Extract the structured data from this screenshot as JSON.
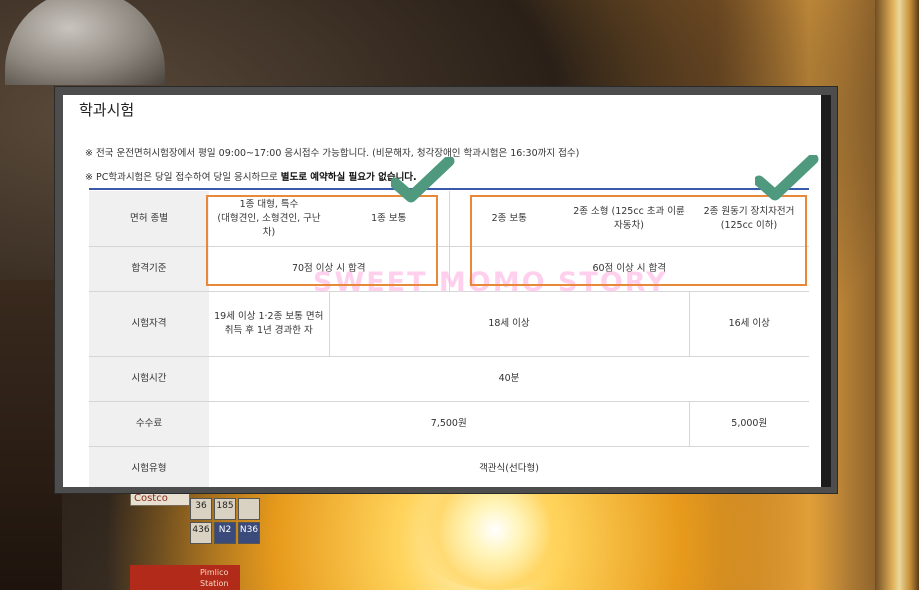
{
  "page": {
    "title": "학과시험",
    "notes": [
      "※ 전국 운전면허시험장에서 평일 09:00~17:00 응시접수 가능합니다. (비문해자, 청각장애인 학과시험은 16:30까지 접수)",
      {
        "prefix": "※ PC학과시험은 당일 접수하여 당일 응시하므로 ",
        "bold": "별도로 예약하실 필요가 없습니다."
      }
    ]
  },
  "watermark": "SWEET MOMO STORY",
  "table": {
    "rows": {
      "license_type": {
        "label": "면허 종별",
        "cells": [
          "1종 대형, 특수\n(대형견인, 소형견인, 구난차)",
          "1종 보통",
          "2종 보통",
          "2종 소형 (125cc 초과 이륜자동차)",
          "2종 원동기 장치자전거 (125cc 이하)"
        ]
      },
      "pass_criteria": {
        "label": "합격기준",
        "cells": [
          "70점 이상 시 합격",
          "60점 이상 시 합격"
        ]
      },
      "eligibility": {
        "label": "시험자격",
        "cells": [
          "19세 이상 1·2종 보통 면허 취득 후 1년 경과한 자",
          "18세 이상",
          "16세 이상"
        ]
      },
      "exam_time": {
        "label": "시험시간",
        "cells": [
          "40분"
        ]
      },
      "fee": {
        "label": "수수료",
        "cells": [
          "7,500원",
          "5,000원"
        ]
      },
      "exam_type": {
        "label": "시험유형",
        "cells": [
          "객관식(선다형)"
        ]
      }
    }
  },
  "background": {
    "shop_sign": "Costco",
    "bus_stops": [
      "36",
      "185",
      "",
      "436",
      "N2",
      "N36"
    ],
    "station_sign": "Pimlico Station"
  },
  "colors": {
    "highlight_box": "#e8893a",
    "check_mark": "#4f9a7e",
    "header_rule": "#3a5aa8",
    "header_cell_bg": "#f0f0f0"
  }
}
